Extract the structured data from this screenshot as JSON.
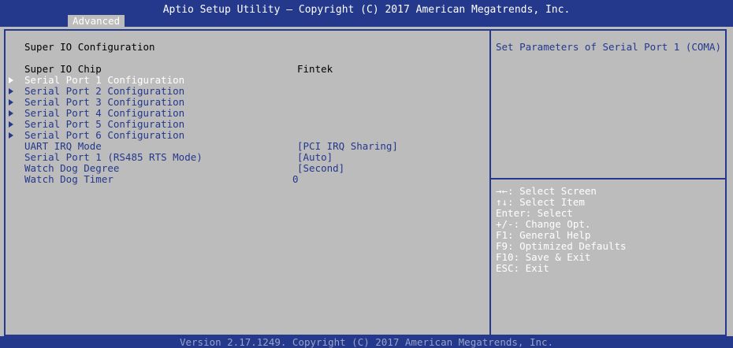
{
  "header": {
    "title": "Aptio Setup Utility – Copyright (C) 2017 American Megatrends, Inc.",
    "tab": "Advanced"
  },
  "main": {
    "page_title": "Super IO Configuration",
    "chip": {
      "label": "Super IO Chip",
      "value": "Fintek"
    },
    "submenus": [
      "Serial Port 1 Configuration",
      "Serial Port 2 Configuration",
      "Serial Port 3 Configuration",
      "Serial Port 4 Configuration",
      "Serial Port 5 Configuration",
      "Serial Port 6 Configuration"
    ],
    "options": [
      {
        "label": "UART IRQ Mode",
        "value": "[PCI IRQ Sharing]"
      },
      {
        "label": "Serial Port 1 (RS485 RTS Mode)",
        "value": "[Auto]"
      },
      {
        "label": "Watch Dog Degree",
        "value": "[Second]"
      },
      {
        "label": "Watch Dog Timer",
        "value": "0"
      }
    ]
  },
  "help": {
    "text": "Set Parameters of Serial Port 1 (COMA)"
  },
  "keys": [
    "→←: Select Screen",
    "↑↓: Select Item",
    "Enter: Select",
    "+/-: Change Opt.",
    "F1: General Help",
    "F9: Optimized Defaults",
    "F10: Save & Exit",
    "ESC: Exit"
  ],
  "footer": {
    "version": "Version 2.17.1249. Copyright (C) 2017 American Megatrends, Inc."
  },
  "colors": {
    "bar": "#24388c",
    "background": "#bcbcbc",
    "selected_text": "#ffffff",
    "static_text": "#000000",
    "option_text": "#24388c"
  }
}
